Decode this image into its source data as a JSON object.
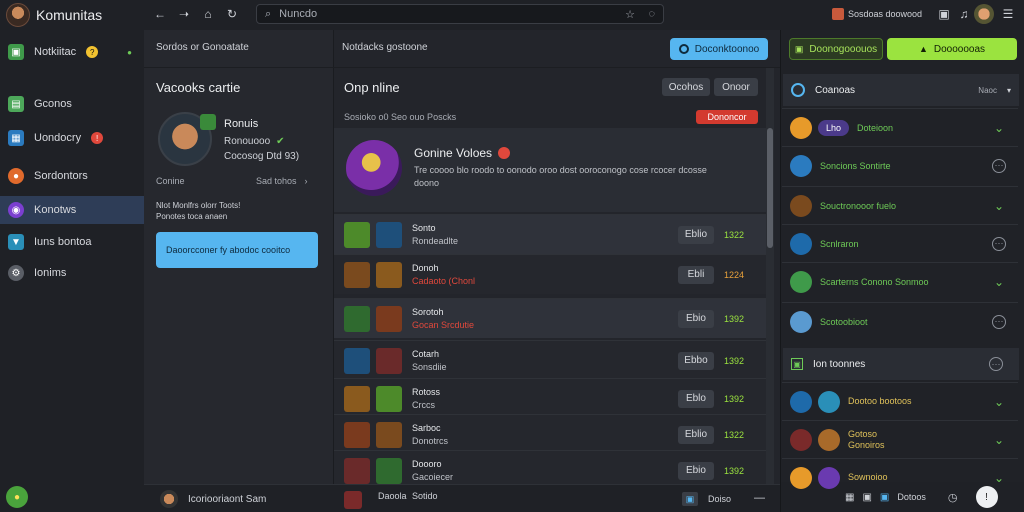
{
  "app": {
    "title": "Komunitas"
  },
  "sidebar": {
    "items": [
      {
        "label": "Notkiitac",
        "badge": "?"
      },
      {
        "label": "Gconos"
      },
      {
        "label": "Uondocry",
        "badge": "!"
      },
      {
        "label": "Sordontors"
      },
      {
        "label": "Konotws"
      },
      {
        "label": "Iuns bontoa"
      },
      {
        "label": "Ionims"
      }
    ]
  },
  "topbar": {
    "search_placeholder": "Nuncdo"
  },
  "col2": {
    "header": "Sordos or Gonoatate",
    "section_title": "Vacooks cartie",
    "profile": {
      "name": "Ronuis",
      "line1": "Ronouooo",
      "line2": "Cocosog Dtd 93)"
    },
    "status_label": "Conine",
    "status_action": "Sad tohos",
    "info_text": "Nlot Monlfrs olorr Toots! Ponotes toca anaen",
    "cta_text": "Daoorcconer fy abodoc cooitco"
  },
  "col3": {
    "header": "Notdacks gostoone",
    "section_title": "Onp nline",
    "btn1": "Ocohos",
    "btn2": "Onoor",
    "meta_left": "Sosioko o0 Seo ouo Poscks",
    "meta_badge": "Dononcor",
    "feature": {
      "title": "Gonine Voloes",
      "desc": "Tre coooo blo roodo to oonodo oroo dost ooroconogo cose rcocer dcosse doono"
    },
    "rows": [
      {
        "line1": "Sonto",
        "line2": "Rondeadlte",
        "btn": "Eblio",
        "value": "1322",
        "value_color": "#9be33f"
      },
      {
        "line1": "Donoh",
        "line2": "Cadaoto (Chonl",
        "btn": "Ebli",
        "value": "1224",
        "value_color": "#e9a23b"
      },
      {
        "line1": "Sorotoh",
        "line2": "Gocan Srcdutie",
        "btn": "Ebio",
        "value": "1392",
        "value_color": "#9be33f"
      },
      {
        "line1": "Cotarh",
        "line2": "Sonsdiie",
        "btn": "Ebbo",
        "value": "1392",
        "value_color": "#9be33f"
      },
      {
        "line1": "Rotoss",
        "line2": "Crccs",
        "btn": "Eblo",
        "value": "1392",
        "value_color": "#9be33f"
      },
      {
        "line1": "Sarboc",
        "line2": "Donotrcs",
        "btn": "Eblio",
        "value": "1322",
        "value_color": "#9be33f"
      },
      {
        "line1": "Doooro",
        "line2": "Gacoiecer",
        "btn": "Ebio",
        "value": "1392",
        "value_color": "#9be33f"
      }
    ],
    "footer_user": "Icoriooriaont Sam",
    "last_row_line1": "Daoola",
    "last_row_line2": "Sotido",
    "footer_counter": "Doiso"
  },
  "topright": {
    "label": "Sosdoas doowood"
  },
  "col4": {
    "btn_blue": "Doconktoonoo",
    "btn_dark": "Doonogooouos",
    "btn_green": "Dooooooas",
    "header": "Coanoas",
    "header_meta": "Naoc",
    "items": [
      {
        "label": "Doteioon",
        "pill": "Lho"
      },
      {
        "label": "Soncions  Sontirte"
      },
      {
        "label": "Souctronooor fuelo"
      },
      {
        "label": "Scnlraron"
      },
      {
        "label": "Scarterns  Conono Sonmoo"
      },
      {
        "label": "Scotoobioot"
      }
    ],
    "section2": "Ion toonnes",
    "items2": [
      {
        "label": "Dootoo bootoos"
      },
      {
        "label": "Gotoso\nGonoiros"
      },
      {
        "label": "Sownoioo"
      }
    ],
    "footer": "Dotoos"
  }
}
